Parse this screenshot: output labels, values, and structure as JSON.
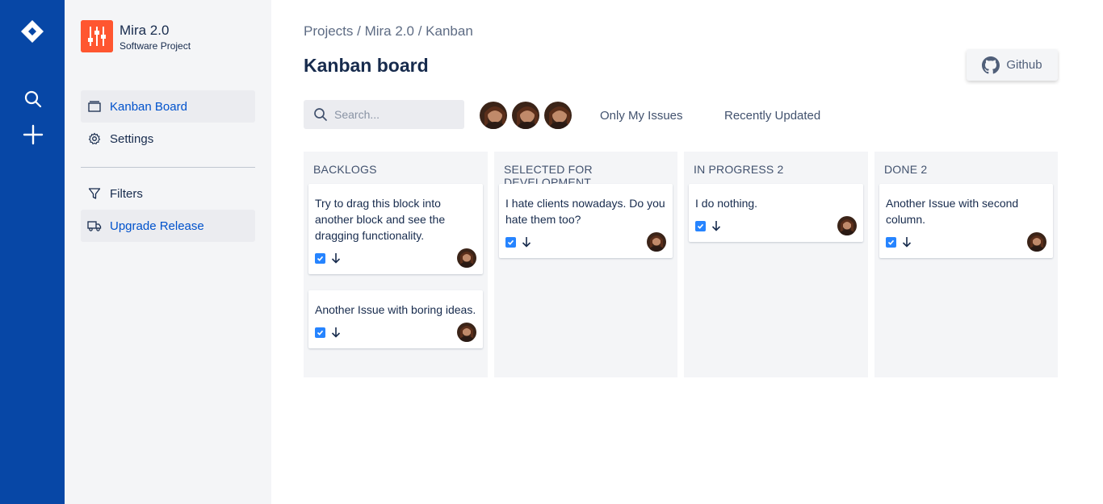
{
  "rail": {
    "logo_icon": "jira-logo-icon",
    "search_icon": "search-icon",
    "create_icon": "plus-icon",
    "background": "#0747a6"
  },
  "sidebar": {
    "project_name": "Mira 2.0",
    "project_type": "Software Project",
    "items": [
      {
        "label": "Kanban Board",
        "icon": "board-icon"
      },
      {
        "label": "Settings",
        "icon": "gear-icon"
      },
      {
        "label": "Filters",
        "icon": "filter-icon"
      },
      {
        "label": "Upgrade Release",
        "icon": "truck-icon"
      }
    ]
  },
  "header": {
    "breadcrumb": "Projects / Mira 2.0 / Kanban",
    "title": "Kanban board",
    "github_label": "Github"
  },
  "toolbar": {
    "search_placeholder": "Search...",
    "filter_only_mine": "Only My Issues",
    "filter_recent": "Recently Updated"
  },
  "board": {
    "columns": [
      {
        "title": "BACKLOGS",
        "cards": [
          {
            "text": "Try to drag this block into another block and see the dragging functionality."
          },
          {
            "text": "Another Issue with boring ideas."
          }
        ]
      },
      {
        "title": "SELECTED FOR DEVELOPMENT",
        "cards": [
          {
            "text": "I hate clients nowadays. Do you hate them too?"
          }
        ]
      },
      {
        "title": "IN PROGRESS 2",
        "cards": [
          {
            "text": "I do nothing."
          }
        ]
      },
      {
        "title": "DONE 2",
        "cards": [
          {
            "text": "Another Issue with second column."
          }
        ]
      }
    ]
  },
  "colors": {
    "accent": "#0052cc",
    "task_check": "#2684ff",
    "project_avatar": "#ff5630"
  }
}
